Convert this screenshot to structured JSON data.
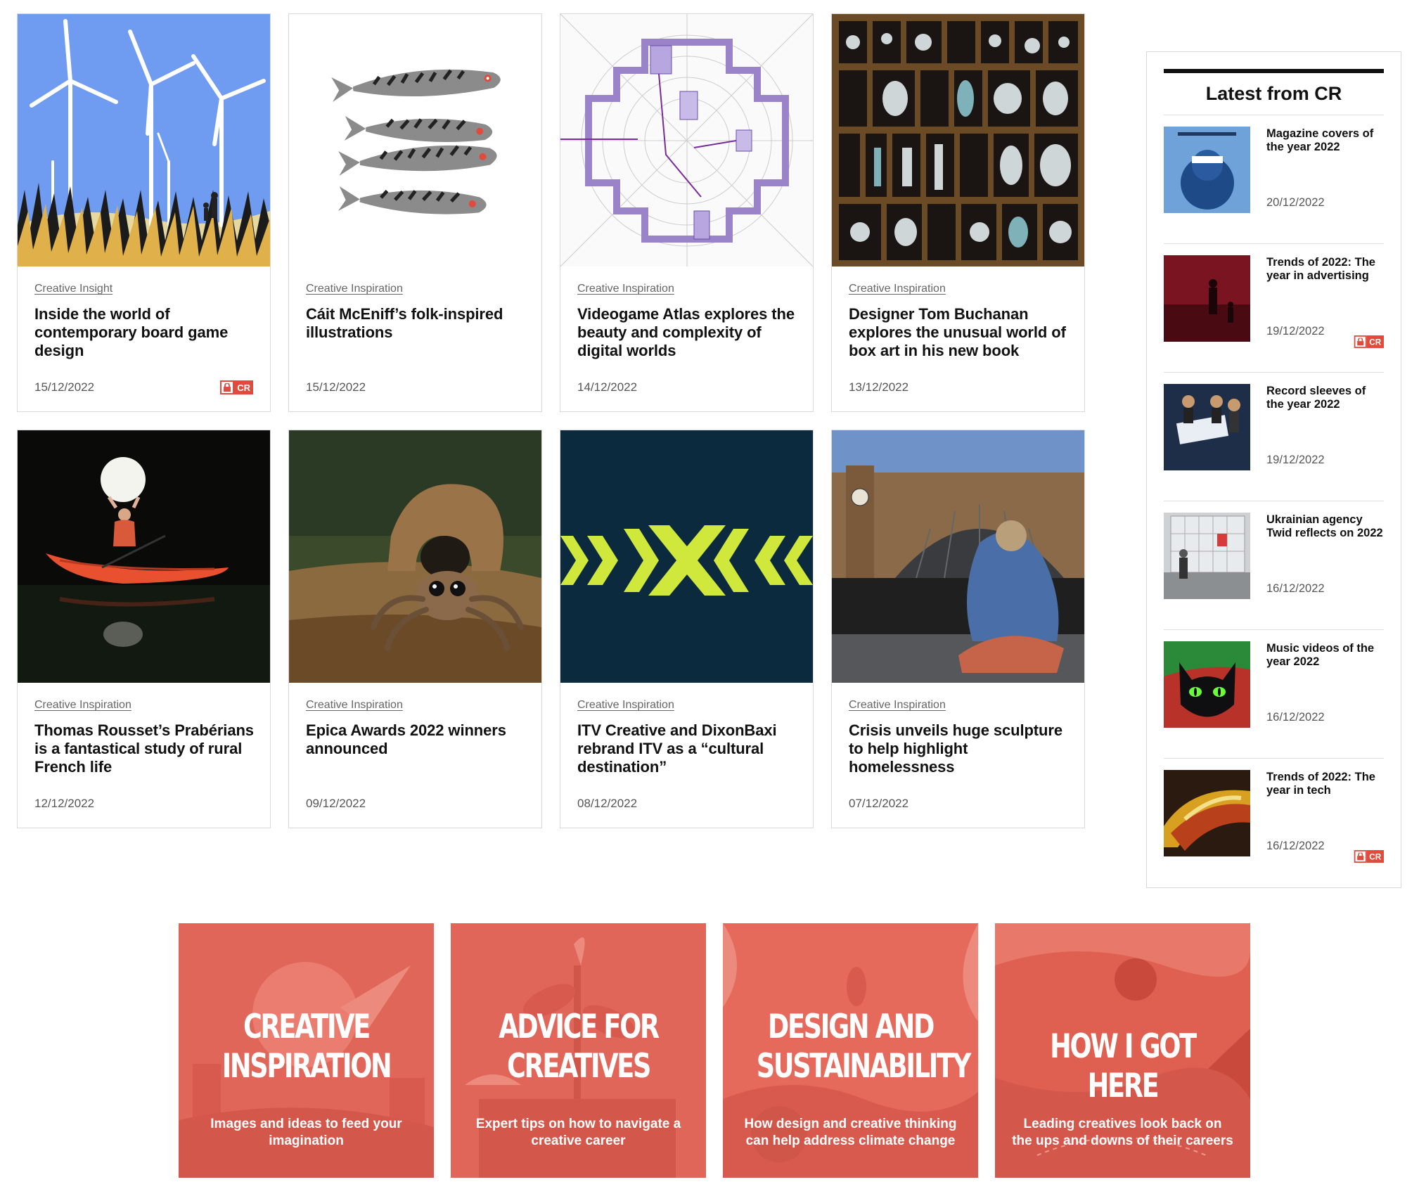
{
  "articles": [
    {
      "category": "Creative Insight",
      "title": "Inside the world of contemporary board game design",
      "date": "15/12/2022",
      "badge": "CR",
      "image": "wind-turbines-illustration"
    },
    {
      "category": "Creative Inspiration",
      "title": "Cáit McEniff’s folk-inspired illustrations",
      "date": "15/12/2022",
      "image": "fish-illustration"
    },
    {
      "category": "Creative Inspiration",
      "title": "Videogame Atlas explores the beauty and complexity of digital worlds",
      "date": "14/12/2022",
      "image": "game-map-drawing"
    },
    {
      "category": "Creative Inspiration",
      "title": "Designer Tom Buchanan explores the unusual world of box art in his new book",
      "date": "13/12/2022",
      "image": "curiosity-box-photo"
    },
    {
      "category": "Creative Inspiration",
      "title": "Thomas Rousset’s Prabérians is a fantastical study of rural French life",
      "date": "12/12/2022",
      "image": "kayak-moon-photo"
    },
    {
      "category": "Creative Inspiration",
      "title": "Epica Awards 2022 winners announced",
      "date": "09/12/2022",
      "image": "spider-photo"
    },
    {
      "category": "Creative Inspiration",
      "title": "ITV Creative and DixonBaxi rebrand ITV as a “cultural destination”",
      "date": "08/12/2022",
      "image": "itv-logo-pattern"
    },
    {
      "category": "Creative Inspiration",
      "title": "Crisis unveils huge sculpture to help highlight homelessness",
      "date": "07/12/2022",
      "image": "sculpture-station-photo"
    }
  ],
  "sidebar": {
    "heading": "Latest from CR",
    "items": [
      {
        "title": "Magazine covers of the year 2022",
        "date": "20/12/2022",
        "image": "magazine-cover"
      },
      {
        "title": "Trends of 2022: The year in advertising",
        "date": "19/12/2022",
        "badge": "CR",
        "image": "advertising-photo"
      },
      {
        "title": "Record sleeves of the year 2022",
        "date": "19/12/2022",
        "image": "record-sleeve"
      },
      {
        "title": "Ukrainian agency Twid reflects on 2022",
        "date": "16/12/2022",
        "image": "agency-photo"
      },
      {
        "title": "Music videos of the year 2022",
        "date": "16/12/2022",
        "image": "black-cat"
      },
      {
        "title": "Trends of 2022: The year in tech",
        "date": "16/12/2022",
        "badge": "CR",
        "image": "abstract-tech"
      }
    ]
  },
  "promos": [
    {
      "title_line1": "CREATIVE",
      "title_line2": "INSPIRATION",
      "text": "Images and ideas to feed your imagination"
    },
    {
      "title_line1": "ADVICE FOR",
      "title_line2": "CREATIVES",
      "text": "Expert tips on how to navigate a creative career"
    },
    {
      "title_line1": "DESIGN AND",
      "title_line2": "SUSTAINABILITY",
      "text": "How design and creative thinking can help address climate change"
    },
    {
      "title_line1": "HOW I GOT HERE",
      "title_line2": "",
      "text": "Leading creatives look back on the ups and downs of their careers"
    }
  ],
  "colors": {
    "accent": "#e14b3d",
    "promo_bg": "#e56a57",
    "border": "#d9d9d9"
  }
}
